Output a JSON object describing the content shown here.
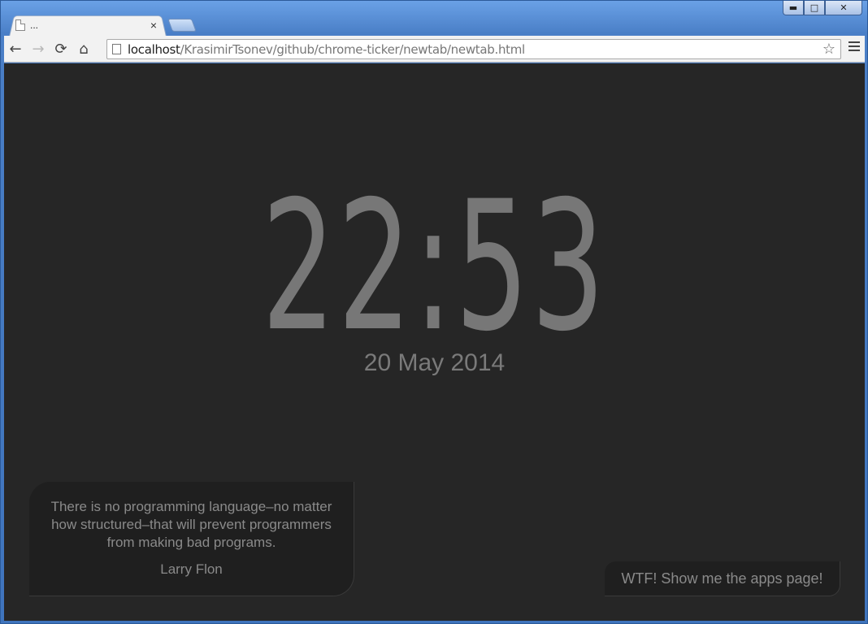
{
  "browser": {
    "tab_title": "...",
    "tab_close": "×",
    "window_controls": {
      "minimize": "▬",
      "maximize": "□",
      "close": "✕"
    },
    "nav": {
      "back": "←",
      "forward": "→",
      "reload": "⟳",
      "home": "⌂"
    },
    "url_host": "localhost",
    "url_path": "/KrasimirTsonev/github/chrome-ticker/newtab/newtab.html",
    "star": "☆"
  },
  "page": {
    "time": "22:53",
    "date": "20 May 2014",
    "quote": {
      "text": "There is no programming language–no matter how structured–that will prevent programmers from making bad programs.",
      "author": "Larry Flon"
    },
    "apps_button_label": "WTF! Show me the apps page!"
  },
  "colors": {
    "background": "#262626",
    "text": "#777777",
    "panel": "#1f1f1f"
  }
}
